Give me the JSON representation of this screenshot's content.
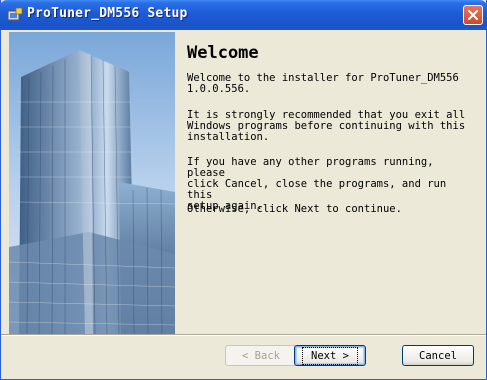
{
  "window": {
    "title": "ProTuner_DM556 Setup"
  },
  "page": {
    "heading": "Welcome",
    "paragraphs": [
      "Welcome to the installer for ProTuner_DM556\n1.0.0.556.",
      "It is strongly recommended that you exit all\nWindows programs before continuing with this\ninstallation.",
      "If you have any other programs running, please\nclick Cancel, close the programs, and run this\nsetup again.",
      "Otherwise, click Next to continue."
    ]
  },
  "buttons": {
    "back": "< Back",
    "next": "Next >",
    "cancel": "Cancel"
  },
  "colors": {
    "titlebar": "#1d5bd6",
    "close": "#cc4a2b",
    "dialog_bg": "#ece9d8"
  }
}
